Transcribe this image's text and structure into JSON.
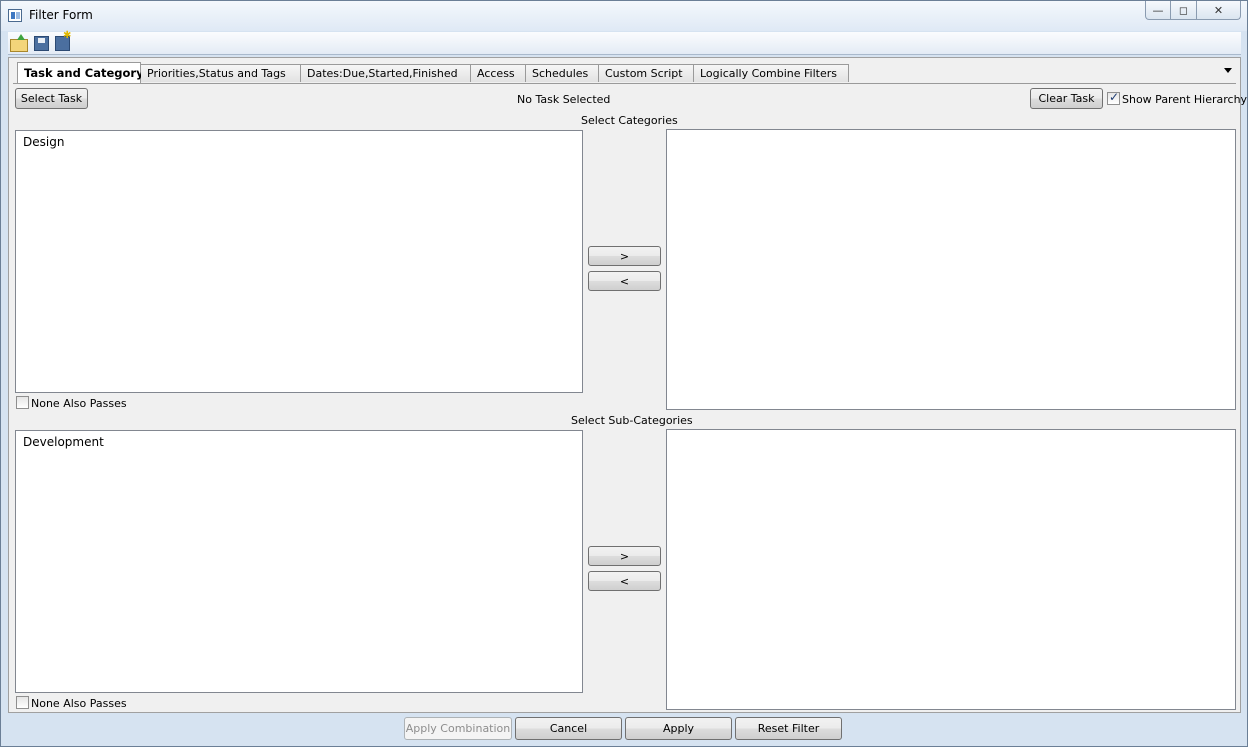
{
  "window": {
    "title": "Filter Form",
    "controls": {
      "minimize": "—",
      "restore": "◻",
      "close": "✕"
    }
  },
  "toolbar": {
    "icons": [
      "open-icon",
      "save-icon",
      "save-as-icon"
    ]
  },
  "tabs": [
    {
      "label": "Task and Category",
      "active": true
    },
    {
      "label": "Priorities,Status and Tags",
      "active": false
    },
    {
      "label": "Dates:Due,Started,Finished",
      "active": false
    },
    {
      "label": "Access",
      "active": false
    },
    {
      "label": "Schedules",
      "active": false
    },
    {
      "label": "Custom Script",
      "active": false
    },
    {
      "label": "Logically Combine Filters",
      "active": false
    }
  ],
  "task": {
    "select_button": "Select Task",
    "status": "No Task Selected",
    "clear_button": "Clear Task",
    "show_parent_label": "Show Parent Hierarchy",
    "show_parent_checked": true
  },
  "categories": {
    "heading": "Select Categories",
    "available": [
      "Design"
    ],
    "selected": [],
    "add_button": ">",
    "remove_button": "<",
    "none_label": "None Also Passes",
    "none_checked": false
  },
  "subcategories": {
    "heading": "Select Sub-Categories",
    "available": [
      "Development"
    ],
    "selected": [],
    "add_button": ">",
    "remove_button": "<",
    "none_label": "None Also Passes",
    "none_checked": false
  },
  "footer": {
    "apply_combination": "Apply Combination",
    "cancel": "Cancel",
    "apply": "Apply",
    "reset": "Reset Filter"
  }
}
